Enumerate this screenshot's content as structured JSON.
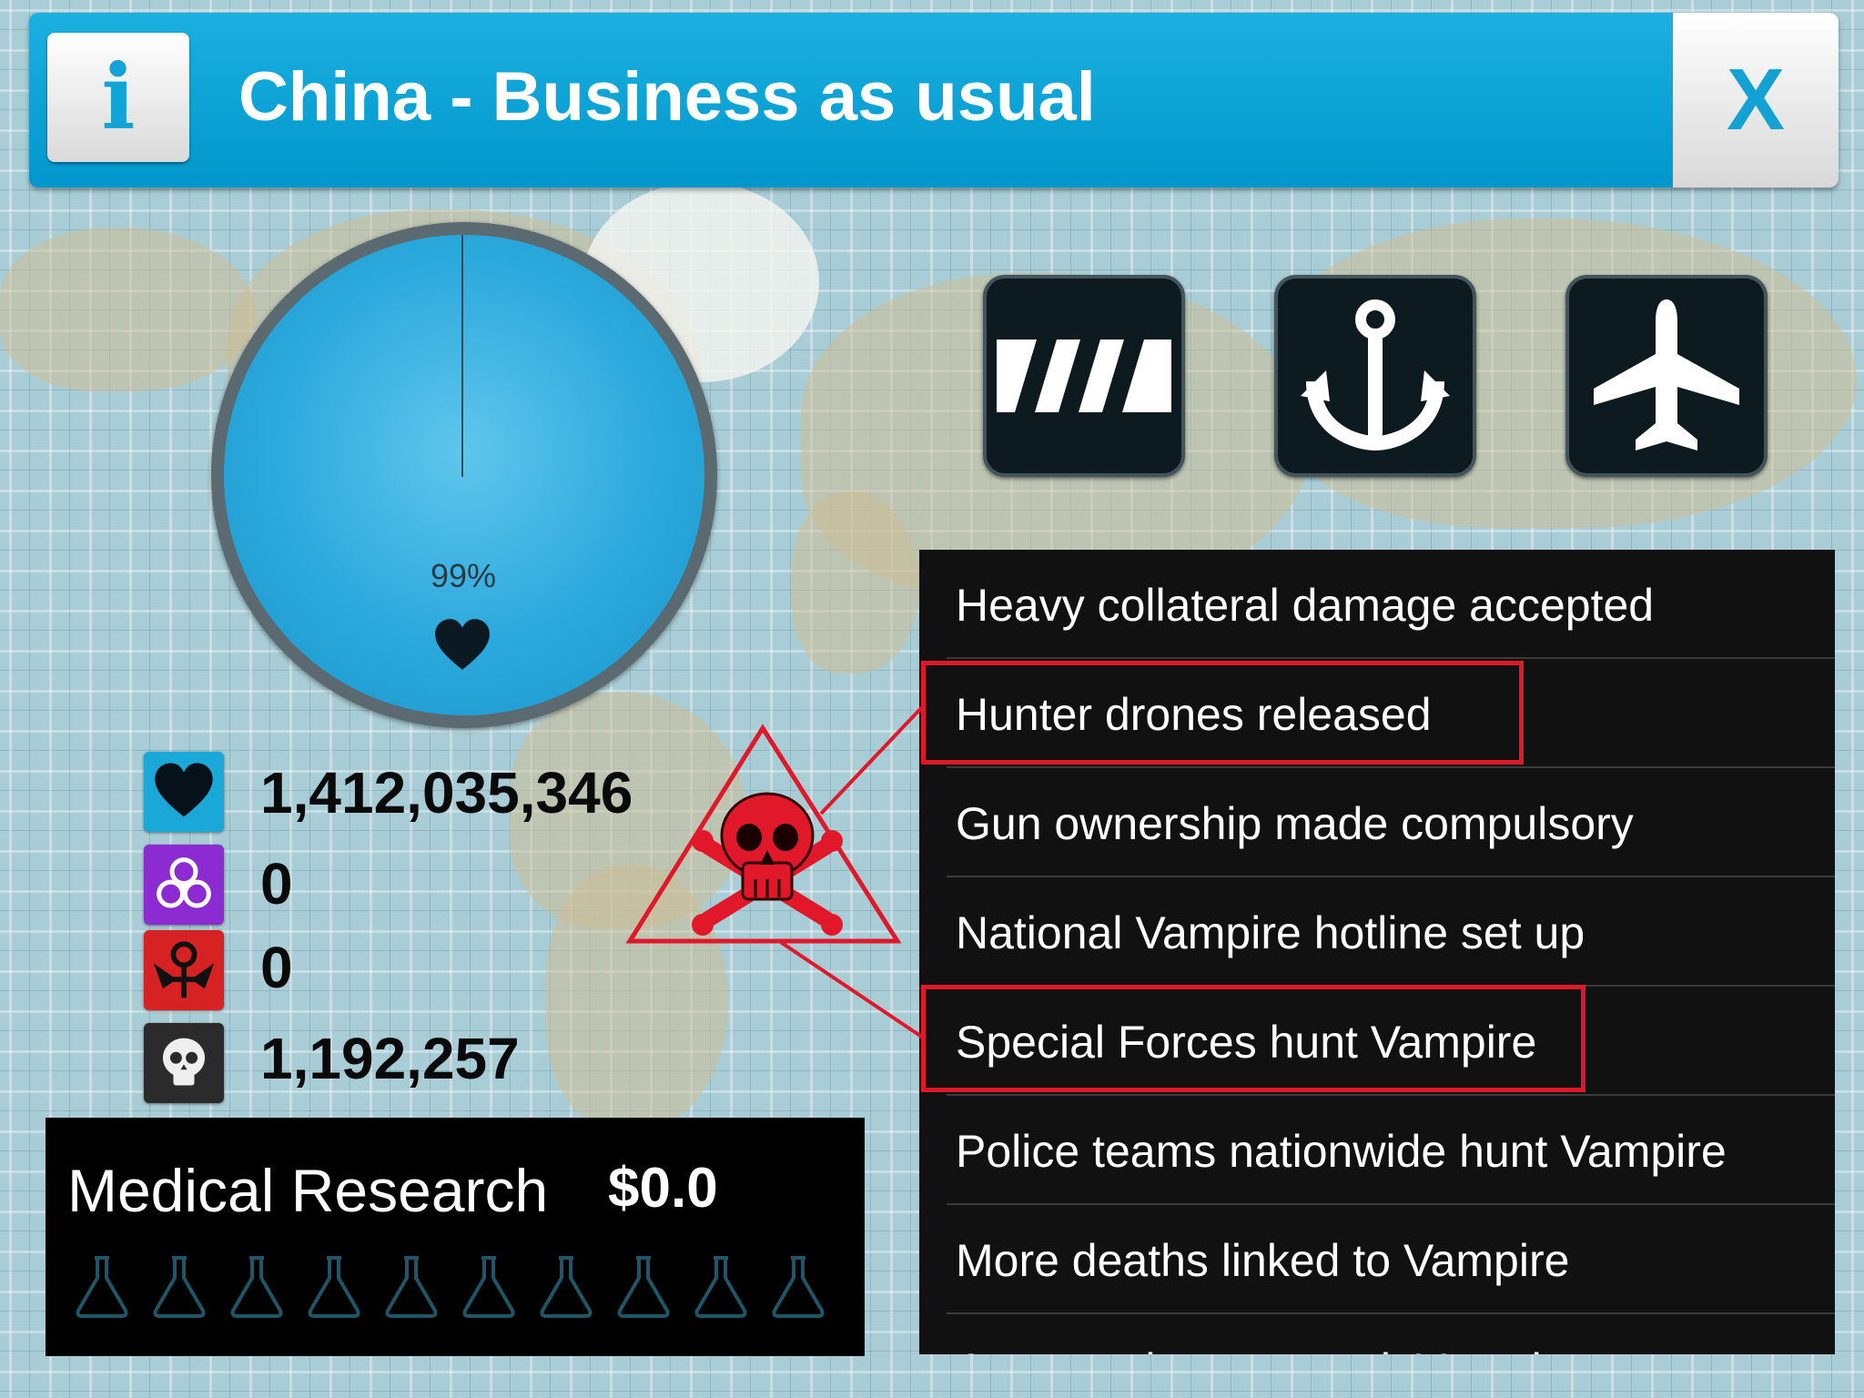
{
  "header": {
    "info_icon": "i",
    "title": "China - Business as usual",
    "close_icon": "X"
  },
  "pie": {
    "percent_label": "99%",
    "healthy_fraction": 0.99
  },
  "stats": [
    {
      "name": "healthy",
      "icon": "heart-icon",
      "value": "1,412,035,346",
      "color": "#19a8d8"
    },
    {
      "name": "infected",
      "icon": "biohazard-icon",
      "value": "0",
      "color": "#8b2bd1"
    },
    {
      "name": "vampire",
      "icon": "vampire-icon",
      "value": "0",
      "color": "#d62222"
    },
    {
      "name": "dead",
      "icon": "skull-icon",
      "value": "1,192,257",
      "color": "#2b2b2b"
    }
  ],
  "medical": {
    "label": "Medical Research",
    "value": "$0.0",
    "flask_count": 10
  },
  "transport": [
    {
      "name": "road-button",
      "icon": "road-icon"
    },
    {
      "name": "port-button",
      "icon": "anchor-icon"
    },
    {
      "name": "airport-button",
      "icon": "airplane-icon"
    }
  ],
  "news": {
    "items": [
      "Heavy collateral damage accepted",
      "Hunter drones released",
      "Gun ownership made compulsory",
      "National Vampire hotline set up",
      "Special Forces hunt Vampire",
      "Police teams nationwide hunt Vampire",
      "More deaths linked to Vampire",
      "Armoured teams track Vampire"
    ],
    "highlighted": [
      1,
      4
    ]
  },
  "annotation": {
    "icon": "red-skull-warning-icon",
    "color": "#e0182a"
  }
}
